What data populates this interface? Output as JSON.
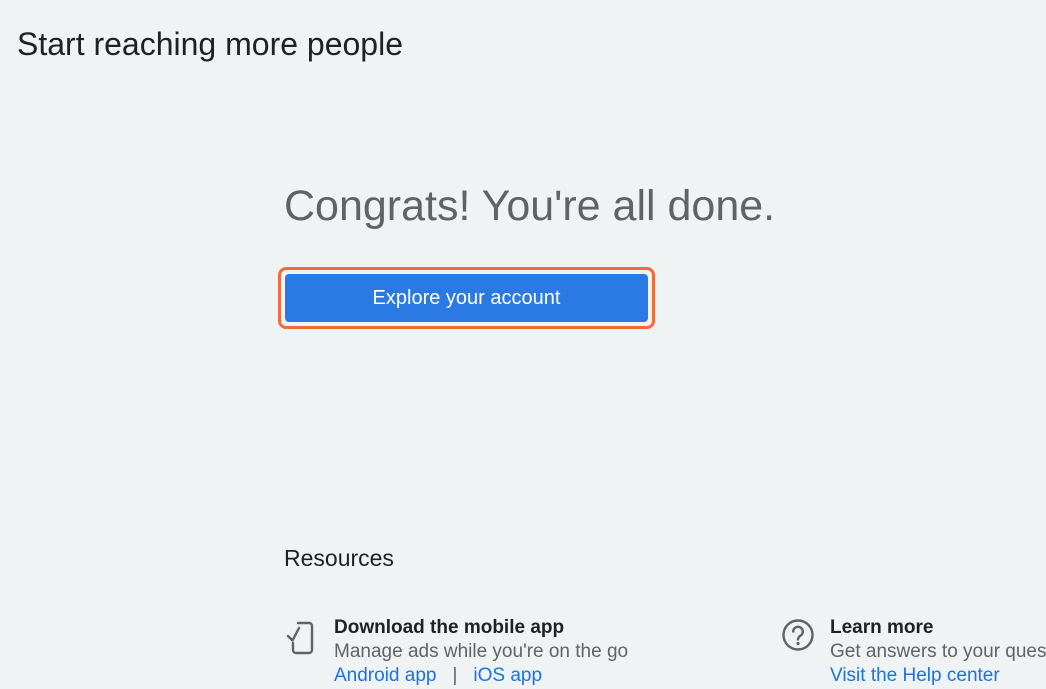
{
  "header": {
    "title": "Start reaching more people"
  },
  "main": {
    "congrats_text": "Congrats! You're all done.",
    "cta_label": "Explore your account",
    "cta_highlight_color": "#f26b3a",
    "cta_color": "#2b7ae4"
  },
  "resources": {
    "heading": "Resources",
    "items": [
      {
        "icon": "mobile-app-icon",
        "title": "Download the mobile app",
        "description": "Manage ads while you're on the go",
        "links": [
          "Android app",
          "iOS app"
        ],
        "separator": "|"
      },
      {
        "icon": "help-icon",
        "title": "Learn more",
        "description": "Get answers to your questions",
        "links": [
          "Visit the Help center"
        ]
      }
    ]
  }
}
